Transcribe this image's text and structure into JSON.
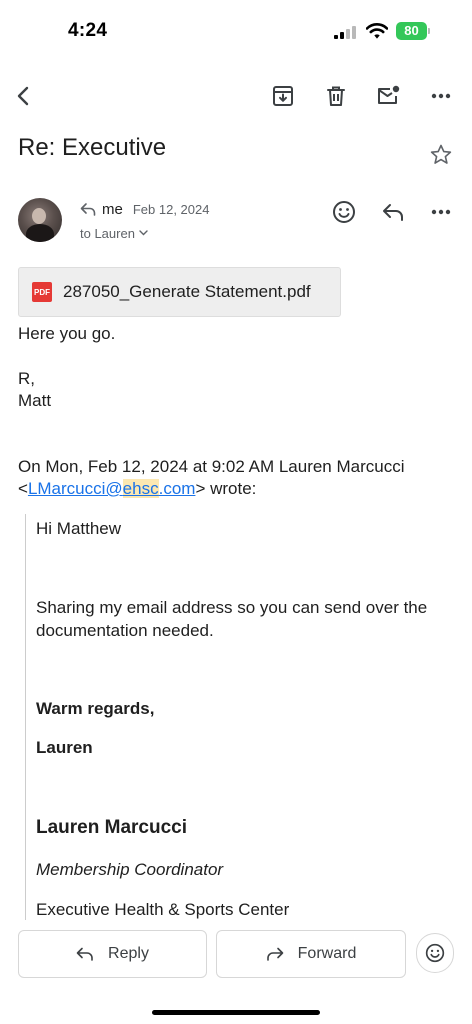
{
  "status_bar": {
    "time": "4:24",
    "battery": "80",
    "battery_color": "#34c759"
  },
  "toolbar": {
    "back_icon": "back-arrow-icon",
    "archive_icon": "archive-icon",
    "delete_icon": "trash-icon",
    "mark_unread_icon": "mark-unread-icon",
    "more_icon": "more-horizontal-icon"
  },
  "subject": "Re: Executive",
  "message": {
    "sender": "me",
    "date": "Feb 12, 2024",
    "recipient": "to Lauren",
    "attachment": {
      "type_label": "PDF",
      "name": "287050_Generate Statement.pdf"
    },
    "body": {
      "line1": "Here you go.",
      "sig1": "R,",
      "sig2": "Matt"
    },
    "quote_header": {
      "line1": "On Mon, Feb 12, 2024 at 9:02 AM Lauren Marcucci",
      "lt": "<",
      "email_part1": "LMarcucci@",
      "email_part2": "ehsc",
      "email_part3": ".com",
      "gt_wrote": "> wrote:"
    },
    "quote": {
      "greeting": "Hi Matthew",
      "body_line1": "Sharing my email address so you can send over the",
      "body_line2": "documentation needed.",
      "closing": "Warm regards,",
      "closing_name": "Lauren",
      "sig_name": "Lauren Marcucci",
      "sig_title": "Membership Coordinator",
      "sig_org": "Executive Health & Sports Center"
    }
  },
  "actions": {
    "reply": "Reply",
    "forward": "Forward"
  },
  "colors": {
    "link": "#1a73e8",
    "highlight": "#fce8b2",
    "pdf_red": "#e53935"
  }
}
